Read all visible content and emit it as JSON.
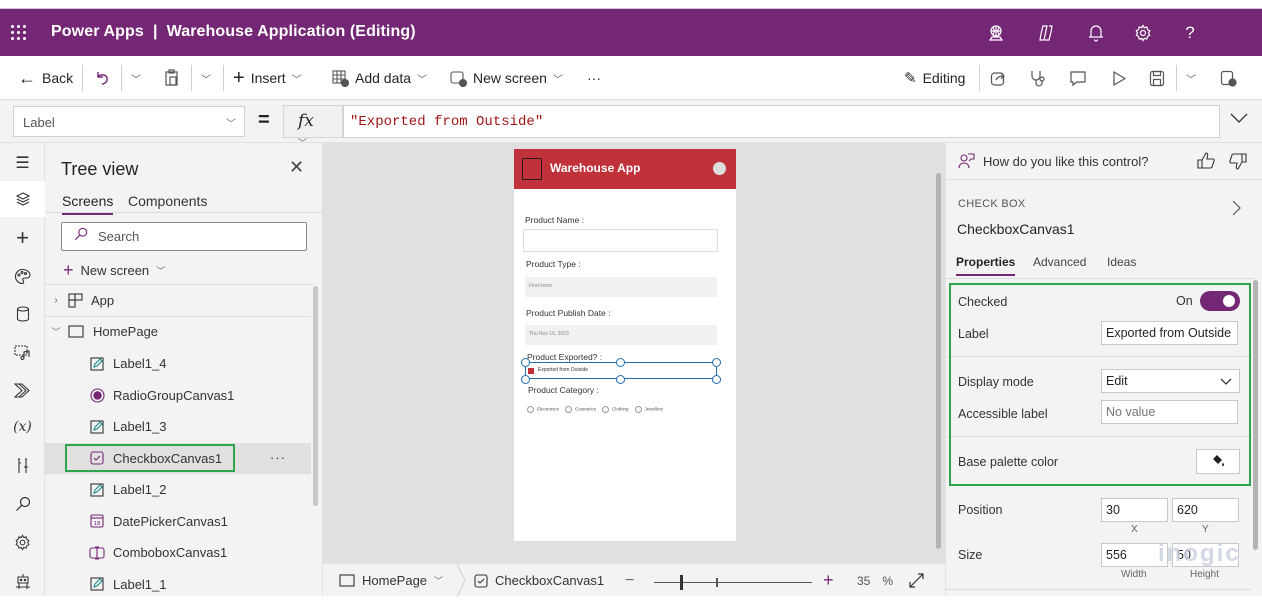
{
  "titlebar": {
    "app_title": "Power Apps  |  Warehouse Application (Editing)",
    "icons": [
      "environment-icon",
      "copilot-icon",
      "notifications-icon",
      "settings-icon",
      "help-icon"
    ],
    "help_glyph": "?"
  },
  "commandbar": {
    "back": "Back",
    "insert": "Insert",
    "add_data": "Add data",
    "new_screen": "New screen",
    "more": "···",
    "editing": "Editing"
  },
  "formula": {
    "property": "Label",
    "equals": "=",
    "fx": "fx",
    "value": "\"Exported from Outside\""
  },
  "tree": {
    "title": "Tree view",
    "tabs": [
      "Screens",
      "Components"
    ],
    "search_placeholder": "Search",
    "new_screen": "New screen",
    "app_node": "App",
    "screen_node": "HomePage",
    "items": [
      {
        "label": "Label1_4",
        "icon": "label-icon"
      },
      {
        "label": "RadioGroupCanvas1",
        "icon": "radio-icon"
      },
      {
        "label": "Label1_3",
        "icon": "label-icon"
      },
      {
        "label": "CheckboxCanvas1",
        "icon": "checkbox-icon",
        "selected": true
      },
      {
        "label": "Label1_2",
        "icon": "label-icon"
      },
      {
        "label": "DatePickerCanvas1",
        "icon": "datepicker-icon"
      },
      {
        "label": "ComboboxCanvas1",
        "icon": "combobox-icon"
      },
      {
        "label": "Label1_1",
        "icon": "label-icon"
      }
    ],
    "more": "···"
  },
  "phone": {
    "title": "Warehouse App",
    "product_name": "Product Name :",
    "product_type": "Product Type :",
    "find_items": "Find items",
    "publish_date": "Product Publish Date :",
    "date_value": "Thu Nov 16, 2023",
    "exported": "Product Exported? :",
    "checkbox_label": "Exported from Outside",
    "category": "Product Category :",
    "radio_options": [
      "Electronics",
      "Cosmetics",
      "Clothing",
      "Jewellery"
    ]
  },
  "statusbar": {
    "screen": "HomePage",
    "control": "CheckboxCanvas1",
    "minus": "−",
    "plus": "+",
    "zoom": "35",
    "zoom_unit": "%"
  },
  "properties": {
    "feedback": "How do you like this control?",
    "type": "CHECK BOX",
    "name": "CheckboxCanvas1",
    "tabs": [
      "Properties",
      "Advanced",
      "Ideas"
    ],
    "checked_label": "Checked",
    "checked_state": "On",
    "checked_value": true,
    "label_label": "Label",
    "label_value": "Exported from Outside",
    "display_mode_label": "Display mode",
    "display_mode_value": "Edit",
    "accessible_label": "Accessible label",
    "accessible_placeholder": "No value",
    "palette_label": "Base palette color",
    "position_label": "Position",
    "x_value": "30",
    "y_value": "620",
    "x_caption": "X",
    "y_caption": "Y",
    "size_label": "Size",
    "width_value": "556",
    "height_value": "50",
    "width_caption": "Width",
    "height_caption": "Height"
  },
  "watermark": "inogic",
  "colors": {
    "brand": "#742774",
    "app_header": "#C0313A",
    "highlight": "#2FA44F",
    "selection": "#1F6FB0"
  }
}
